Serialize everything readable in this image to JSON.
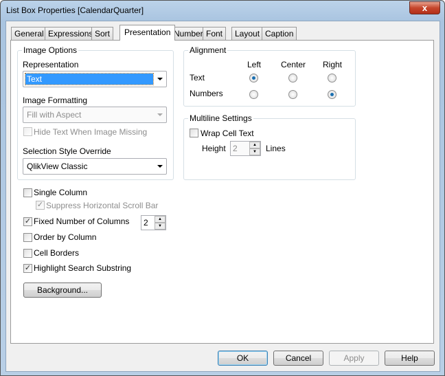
{
  "window": {
    "title": "List Box Properties [CalendarQuarter]",
    "close": "x"
  },
  "tabs": [
    "General",
    "Expressions",
    "Sort",
    "Presentation",
    "Number",
    "Font",
    "Layout",
    "Caption"
  ],
  "image_options": {
    "label": "Image Options",
    "representation_label": "Representation",
    "representation_value": "Text",
    "formatting_label": "Image Formatting",
    "formatting_value": "Fill with Aspect",
    "hide_text": "Hide Text When Image Missing",
    "hide_text_checked": false,
    "selection_style_label": "Selection Style Override",
    "selection_style_value": "QlikView Classic"
  },
  "alignment": {
    "label": "Alignment",
    "columns": [
      "Left",
      "Center",
      "Right"
    ],
    "rows": [
      {
        "label": "Text",
        "selected": "Left"
      },
      {
        "label": "Numbers",
        "selected": "Right"
      }
    ]
  },
  "multiline": {
    "label": "Multiline Settings",
    "wrap": "Wrap Cell Text",
    "wrap_checked": false,
    "height_label": "Height",
    "height_value": "2",
    "lines_label": "Lines"
  },
  "options": {
    "single_column": "Single Column",
    "single_column_checked": false,
    "suppress_hscroll": "Suppress Horizontal Scroll Bar",
    "suppress_hscroll_checked": true,
    "fixed_columns": "Fixed Number of Columns",
    "fixed_columns_checked": true,
    "fixed_columns_value": "2",
    "order_by_column": "Order by Column",
    "order_by_column_checked": false,
    "cell_borders": "Cell Borders",
    "cell_borders_checked": false,
    "highlight": "Highlight Search Substring",
    "highlight_checked": true,
    "background_button": "Background..."
  },
  "buttons": {
    "ok": "OK",
    "cancel": "Cancel",
    "apply": "Apply",
    "help": "Help"
  }
}
